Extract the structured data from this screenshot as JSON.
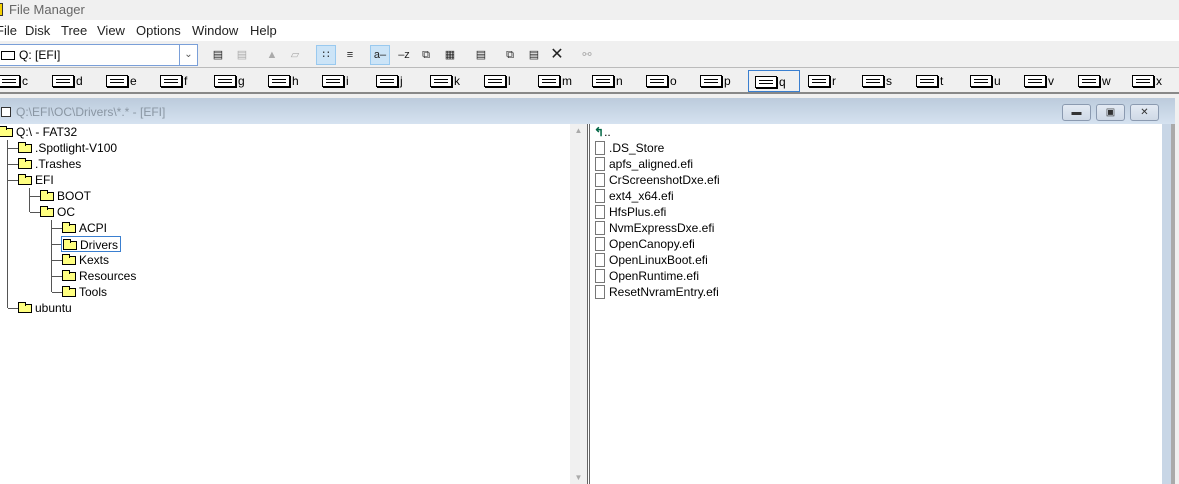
{
  "app": {
    "title": "File Manager"
  },
  "menu": [
    "File",
    "Disk",
    "Tree",
    "View",
    "Options",
    "Window",
    "Help"
  ],
  "drive_select": {
    "value": "Q: [EFI]"
  },
  "drives": [
    "c",
    "d",
    "e",
    "f",
    "g",
    "h",
    "i",
    "j",
    "k",
    "l",
    "m",
    "n",
    "o",
    "p",
    "q",
    "r",
    "s",
    "t",
    "u",
    "v",
    "w",
    "x"
  ],
  "selected_drive": "q",
  "child": {
    "title": "Q:\\EFI\\OC\\Drivers\\*.* - [EFI]"
  },
  "tree": [
    {
      "label": "Q:\\ - FAT32",
      "depth": 0
    },
    {
      "label": ".Spotlight-V100",
      "depth": 1
    },
    {
      "label": ".Trashes",
      "depth": 1
    },
    {
      "label": "EFI",
      "depth": 1
    },
    {
      "label": "BOOT",
      "depth": 2
    },
    {
      "label": "OC",
      "depth": 2
    },
    {
      "label": "ACPI",
      "depth": 3
    },
    {
      "label": "Drivers",
      "depth": 3,
      "selected": true
    },
    {
      "label": "Kexts",
      "depth": 3
    },
    {
      "label": "Resources",
      "depth": 3
    },
    {
      "label": "Tools",
      "depth": 3
    },
    {
      "label": "ubuntu",
      "depth": 1
    }
  ],
  "files": {
    "up": "..",
    "items": [
      ".DS_Store",
      "apfs_aligned.efi",
      "CrScreenshotDxe.efi",
      "ext4_x64.efi",
      "HfsPlus.efi",
      "NvmExpressDxe.efi",
      "OpenCanopy.efi",
      "OpenLinuxBoot.efi",
      "OpenRuntime.efi",
      "ResetNvramEntry.efi"
    ]
  }
}
